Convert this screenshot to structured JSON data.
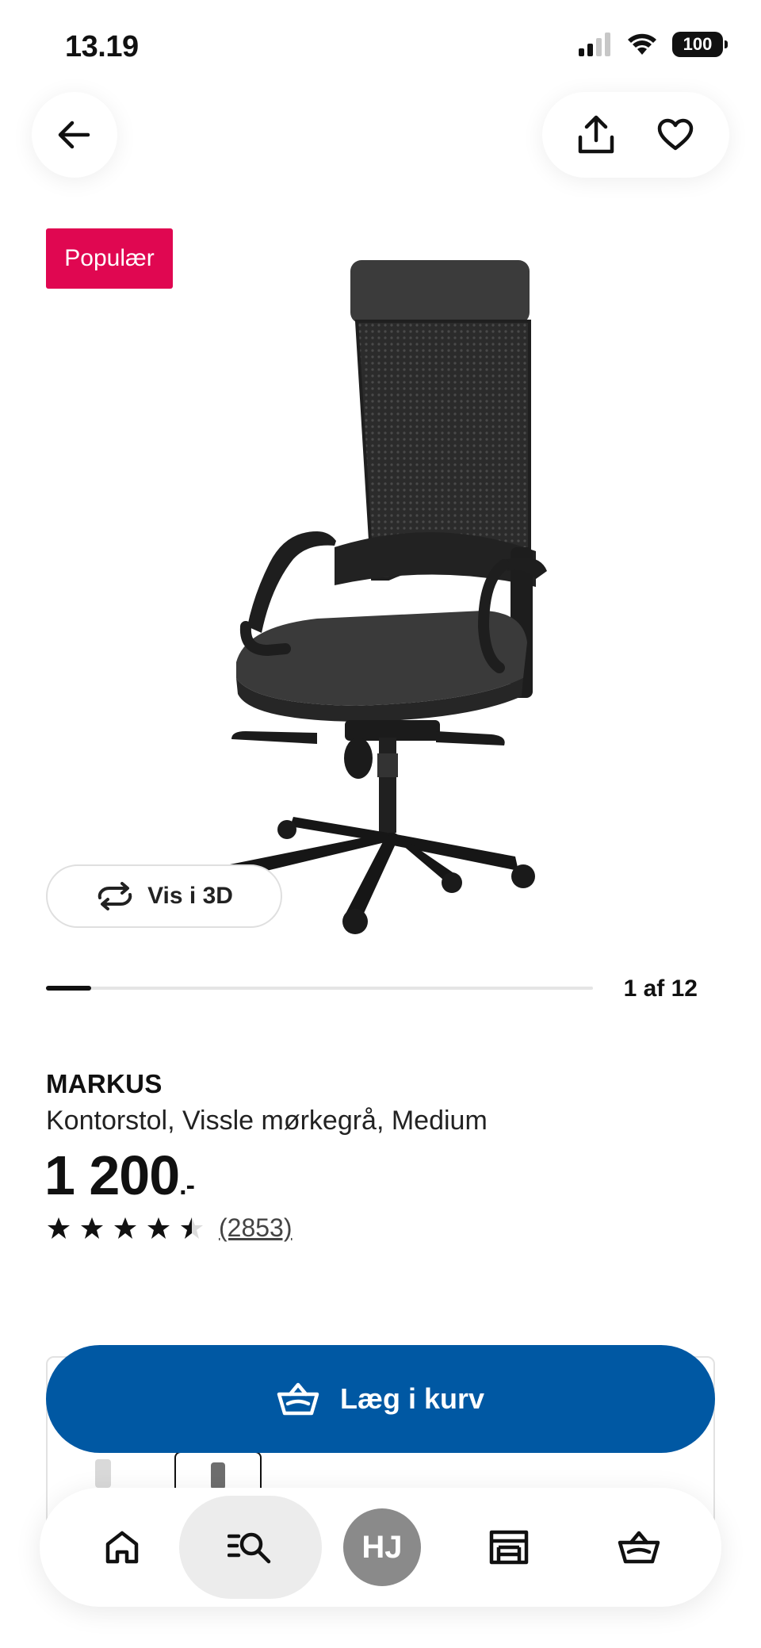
{
  "status_bar": {
    "time": "13.19",
    "battery": "100"
  },
  "product": {
    "badge": "Populær",
    "view_3d_label": "Vis i 3D",
    "gallery": {
      "counter": "1 af 12",
      "current": 1,
      "total": 12
    },
    "name": "MARKUS",
    "description": "Kontorstol, Vissle mørkegrå, Medium",
    "price": "1 200",
    "price_suffix": ".-",
    "rating": {
      "stars": 4.5,
      "max": 5,
      "count_label": "(2853)"
    }
  },
  "cart_button": {
    "label": "Læg i kurv"
  },
  "bottom_nav": {
    "avatar_initials": "HJ"
  },
  "colors": {
    "brand_blue": "#0058a3",
    "badge_red": "#e00751",
    "avatar_gray": "#8a8a8a"
  }
}
